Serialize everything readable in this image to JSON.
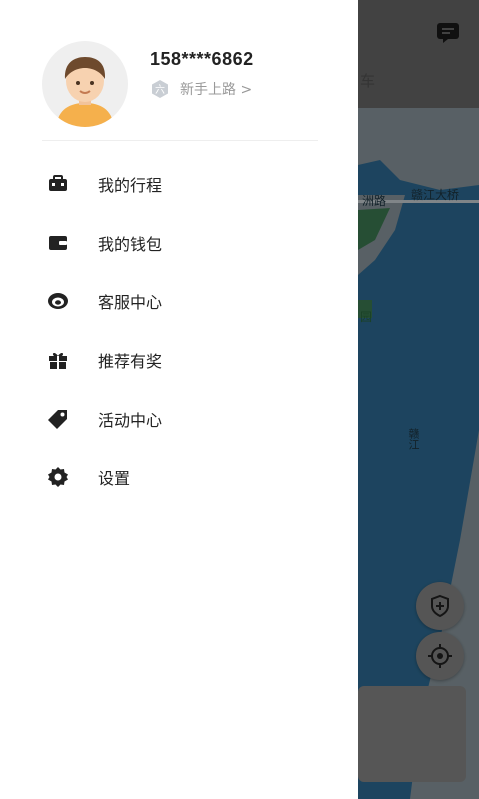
{
  "map": {
    "tab_label": "车",
    "road_labels": {
      "zhoulu": "洲路",
      "bridge": "赣江大桥",
      "park": "园",
      "river": "赣江"
    }
  },
  "profile": {
    "phone": "158****6862",
    "level": "新手上路 >"
  },
  "menu": [
    {
      "label": "我的行程",
      "icon": "trip-icon"
    },
    {
      "label": "我的钱包",
      "icon": "wallet-icon"
    },
    {
      "label": "客服中心",
      "icon": "customer-service-icon"
    },
    {
      "label": "推荐有奖",
      "icon": "gift-icon"
    },
    {
      "label": "活动中心",
      "icon": "tag-icon"
    },
    {
      "label": "设置",
      "icon": "gear-icon"
    }
  ]
}
